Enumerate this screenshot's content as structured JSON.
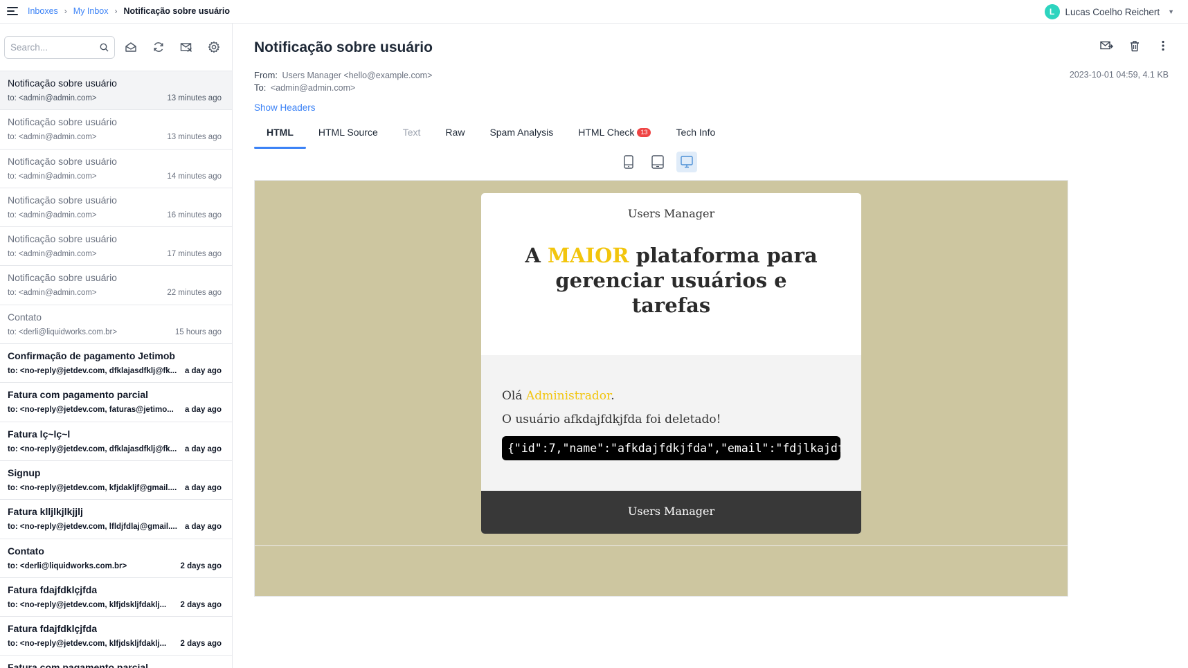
{
  "breadcrumb": {
    "inboxes": "Inboxes",
    "my_inbox": "My Inbox",
    "current": "Notificação sobre usuário"
  },
  "user": {
    "initial": "L",
    "name": "Lucas Coelho Reichert"
  },
  "search": {
    "placeholder": "Search..."
  },
  "messages": [
    {
      "subject": "Notificação sobre usuário",
      "to": "to: <admin@admin.com>",
      "time": "13 minutes ago",
      "state": "selected"
    },
    {
      "subject": "Notificação sobre usuário",
      "to": "to: <admin@admin.com>",
      "time": "13 minutes ago",
      "state": "read"
    },
    {
      "subject": "Notificação sobre usuário",
      "to": "to: <admin@admin.com>",
      "time": "14 minutes ago",
      "state": "read"
    },
    {
      "subject": "Notificação sobre usuário",
      "to": "to: <admin@admin.com>",
      "time": "16 minutes ago",
      "state": "read"
    },
    {
      "subject": "Notificação sobre usuário",
      "to": "to: <admin@admin.com>",
      "time": "17 minutes ago",
      "state": "read"
    },
    {
      "subject": "Notificação sobre usuário",
      "to": "to: <admin@admin.com>",
      "time": "22 minutes ago",
      "state": "read"
    },
    {
      "subject": "Contato",
      "to": "to: <derli@liquidworks.com.br>",
      "time": "15 hours ago",
      "state": "read"
    },
    {
      "subject": "Confirmação de pagamento Jetimob",
      "to": "to: <no-reply@jetdev.com, dfklajasdfklj@fk...",
      "time": "a day ago",
      "state": "unread"
    },
    {
      "subject": "Fatura com pagamento parcial",
      "to": "to: <no-reply@jetdev.com, faturas@jetimo...",
      "time": "a day ago",
      "state": "unread"
    },
    {
      "subject": "Fatura lç~lç~l",
      "to": "to: <no-reply@jetdev.com, dfklajasdfklj@fk...",
      "time": "a day ago",
      "state": "unread"
    },
    {
      "subject": "Signup",
      "to": "to: <no-reply@jetdev.com, kfjdakljf@gmail....",
      "time": "a day ago",
      "state": "unread"
    },
    {
      "subject": "Fatura klljlkjlkjjlj",
      "to": "to: <no-reply@jetdev.com, lfldjfdlaj@gmail....",
      "time": "a day ago",
      "state": "unread"
    },
    {
      "subject": "Contato",
      "to": "to: <derli@liquidworks.com.br>",
      "time": "2 days ago",
      "state": "unread"
    },
    {
      "subject": "Fatura fdajfdklçjfda",
      "to": "to: <no-reply@jetdev.com, klfjdskljfdaklj...",
      "time": "2 days ago",
      "state": "unread"
    },
    {
      "subject": "Fatura fdajfdklçjfda",
      "to": "to: <no-reply@jetdev.com, klfjdskljfdaklj...",
      "time": "2 days ago",
      "state": "unread"
    },
    {
      "subject": "Fatura com pagamento parcial",
      "to": "",
      "time": "",
      "state": "unread"
    }
  ],
  "email": {
    "subject": "Notificação sobre usuário",
    "from_label": "From:",
    "from": "Users Manager <hello@example.com>",
    "to_label": "To:",
    "to": "<admin@admin.com>",
    "date_size": "2023-10-01 04:59, 4.1 KB",
    "show_headers": "Show Headers"
  },
  "tabs": {
    "html": "HTML",
    "html_source": "HTML Source",
    "text": "Text",
    "raw": "Raw",
    "spam": "Spam Analysis",
    "html_check": "HTML Check",
    "html_check_count": "13",
    "tech_info": "Tech Info"
  },
  "preview": {
    "brand": "Users Manager",
    "headline_pre": "A ",
    "headline_highlight": "MAIOR",
    "headline_post": " plataforma para gerenciar usuários e tarefas",
    "greeting_pre": "Olá ",
    "greeting_name": "Administrador",
    "greeting_post": ".",
    "message": "O usuário afkdajfdkjfda foi deletado!",
    "code": "{\"id\":7,\"name\":\"afkdajfdkjfda\",\"email\":\"fdjlkajdf",
    "footer": "Users Manager"
  },
  "colors": {
    "accent": "#3b82f6",
    "preview_bg": "#cdc6a0",
    "highlight": "#f2c50d",
    "badge": "#ef4444",
    "avatar": "#2dd4bf"
  }
}
